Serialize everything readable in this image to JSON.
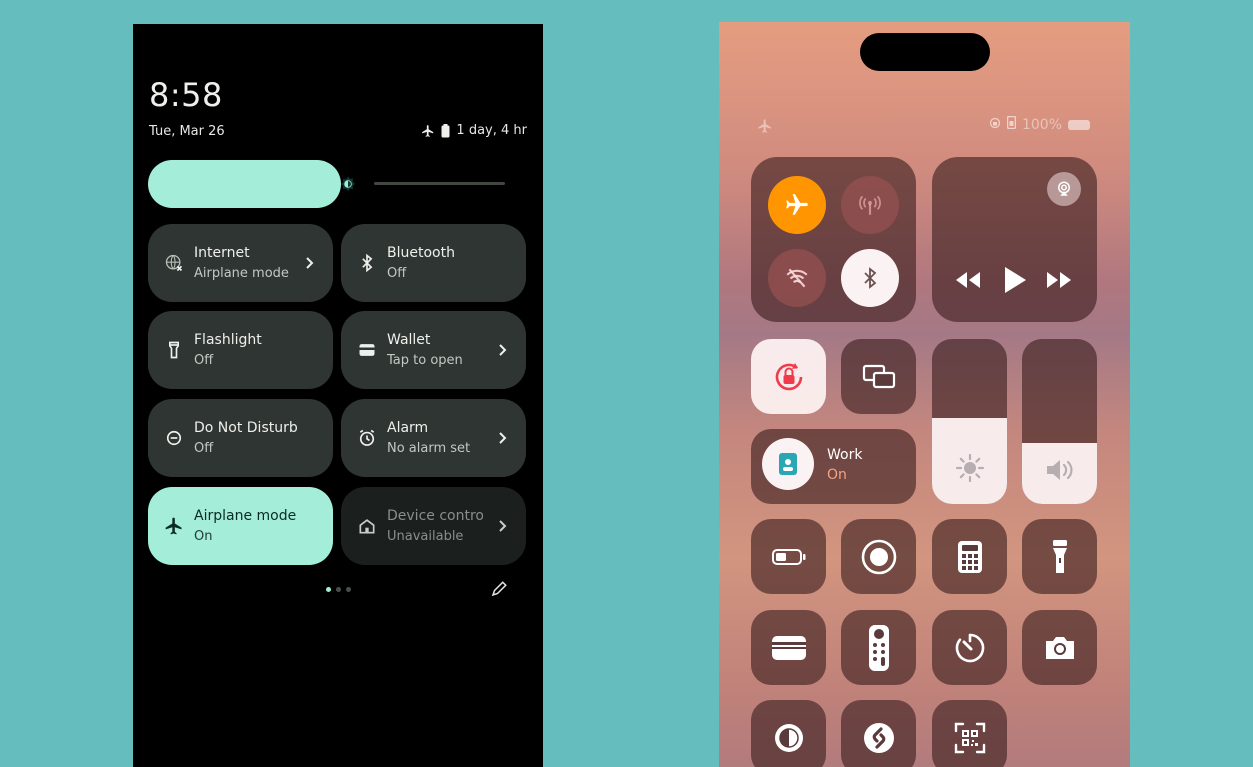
{
  "android": {
    "time": "8:58",
    "date": "Tue, Mar 26",
    "battery_text": "1 day, 4 hr",
    "brightness_percent": 54,
    "accent_color": "#a3edd9",
    "tiles": [
      {
        "title": "Internet",
        "subtitle": "Airplane mode",
        "icon": "globe-off-icon",
        "state": "off",
        "chevron": true
      },
      {
        "title": "Bluetooth",
        "subtitle": "Off",
        "icon": "bluetooth-icon",
        "state": "off",
        "chevron": false
      },
      {
        "title": "Flashlight",
        "subtitle": "Off",
        "icon": "flashlight-icon",
        "state": "off",
        "chevron": false
      },
      {
        "title": "Wallet",
        "subtitle": "Tap to open",
        "icon": "wallet-icon",
        "state": "off",
        "chevron": true
      },
      {
        "title": "Do Not Disturb",
        "subtitle": "Off",
        "icon": "dnd-icon",
        "state": "off",
        "chevron": false
      },
      {
        "title": "Alarm",
        "subtitle": "No alarm set",
        "icon": "alarm-icon",
        "state": "off",
        "chevron": true
      },
      {
        "title": "Airplane mode",
        "subtitle": "On",
        "icon": "airplane-icon",
        "state": "on",
        "chevron": false
      },
      {
        "title": "Device control",
        "subtitle": "Unavailable",
        "icon": "home-icon",
        "state": "unavailable",
        "chevron": true
      }
    ],
    "page_indicator": {
      "pages": 3,
      "active": 0
    }
  },
  "ios": {
    "status_battery": "100%",
    "airplane_color": "#ff9500",
    "focus": {
      "title": "Work",
      "subtitle": "On",
      "subtitle_color": "#f6a37f"
    },
    "brightness_level": 0.52,
    "volume_level": 0.37,
    "toggles": [
      "airplane-mode-toggle",
      "cellular-toggle",
      "wifi-toggle",
      "bluetooth-toggle"
    ],
    "media_controls": [
      "rewind-icon",
      "play-icon",
      "fast-forward-icon",
      "airplay-icon"
    ],
    "shortcuts": [
      "low-power-mode-icon",
      "screen-record-icon",
      "calculator-icon",
      "flashlight-icon",
      "wallet-icon",
      "apple-tv-remote-icon",
      "timer-icon",
      "camera-icon",
      "dark-mode-icon",
      "shazam-icon",
      "qr-code-scanner-icon"
    ]
  }
}
